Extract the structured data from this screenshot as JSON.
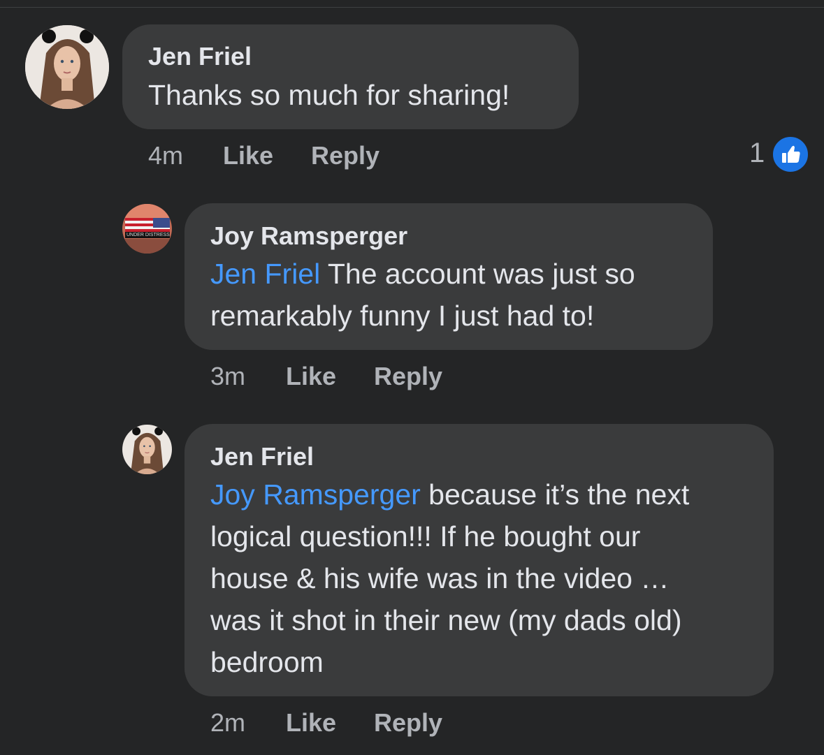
{
  "comments": [
    {
      "author": "Jen Friel",
      "mention": "",
      "text": "Thanks so much for sharing!",
      "time": "4m",
      "like_label": "Like",
      "reply_label": "Reply",
      "reaction_count": "1",
      "reaction_icon": "thumbs-up-icon"
    },
    {
      "author": "Joy Ramsperger",
      "mention": "Jen Friel",
      "text_line1": " The account was just so",
      "text_line2": "remarkably funny I just had to!",
      "avatar_caption": "UNDER DISTRESS",
      "time": "3m",
      "like_label": "Like",
      "reply_label": "Reply"
    },
    {
      "author": "Jen Friel",
      "mention": "Joy Ramsperger",
      "text_line1": " because it’s the next",
      "text_line2": "logical question!!! If he bought our",
      "text_line3": "house & his wife was in the video …",
      "text_line4": "was it shot in their new (my dads old)",
      "text_line5": "bedroom",
      "time": "2m",
      "like_label": "Like",
      "reply_label": "Reply"
    }
  ],
  "colors": {
    "background": "#242526",
    "bubble": "#3a3b3c",
    "mention": "#4599ff",
    "meta": "#b0b3b8",
    "like_badge": "#1b74e4"
  }
}
